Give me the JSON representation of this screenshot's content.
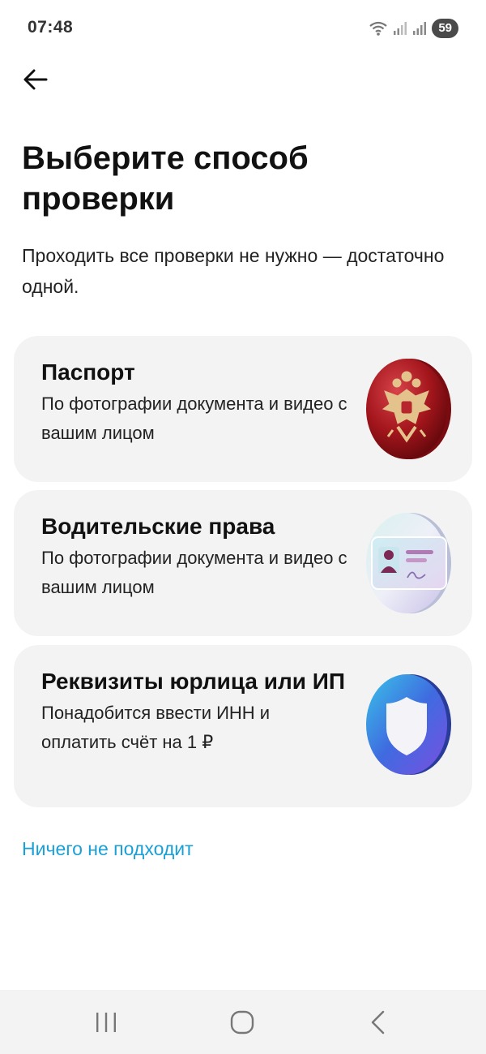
{
  "status_bar": {
    "time": "07:48",
    "battery": "59",
    "icons": [
      "wifi-icon",
      "signal-icon",
      "signal-icon",
      "battery-icon"
    ]
  },
  "header": {
    "back_icon": "arrow-left-icon"
  },
  "title": "Выберите способ проверки",
  "subtitle": "Проходить все проверки не нужно — достаточно одной.",
  "options": [
    {
      "title": "Паспорт",
      "description": "По фотографии документа и видео с вашим лицом",
      "icon": "passport-emblem-icon"
    },
    {
      "title": "Водительские права",
      "description": "По фотографии документа и видео с вашим лицом",
      "icon": "driver-license-icon"
    },
    {
      "title": "Реквизиты юрлица или ИП",
      "description": "Понадобится ввести ИНН и оплатить счёт на 1 ₽",
      "icon": "shield-icon"
    }
  ],
  "nothing_fits_link": "Ничего не подходит",
  "colors": {
    "link": "#1a9fd6",
    "card_background": "#f3f3f3",
    "passport_red": "#a3161c",
    "shield_blue": "#3f6be0"
  },
  "nav_bar": {
    "icons": [
      "recents-icon",
      "home-icon",
      "back-icon"
    ]
  }
}
